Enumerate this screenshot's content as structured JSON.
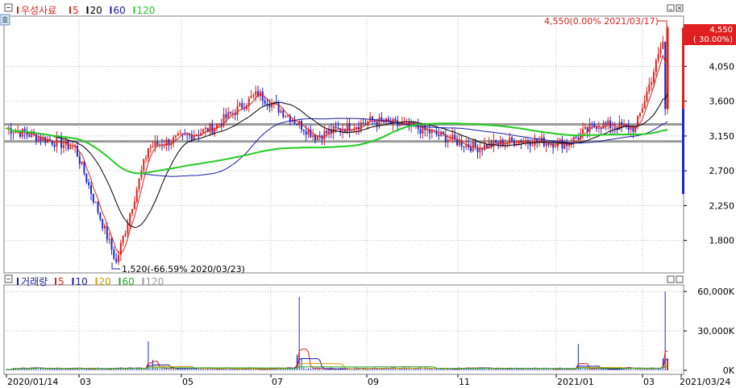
{
  "price_panel": {
    "stock_name": "우성사료",
    "ma_legend": [
      {
        "label": "5",
        "color": "#e0201a"
      },
      {
        "label": "20",
        "color": "#000000"
      },
      {
        "label": "60",
        "color": "#1a1aa8"
      },
      {
        "label": "120",
        "color": "#22cc22"
      }
    ],
    "max_annotation": "4,550(0.00% 2021/03/17)",
    "min_annotation": "1,520(-66.59% 2020/03/23)",
    "current_price_label": "4,550",
    "current_change_label": "( 30.00%)"
  },
  "volume_panel": {
    "title": "거래량",
    "ma_legend": [
      {
        "label": "5",
        "color": "#e0201a"
      },
      {
        "label": "10",
        "color": "#1a1aa8"
      },
      {
        "label": "20",
        "color": "#d49a00"
      },
      {
        "label": "60",
        "color": "#22aa22"
      },
      {
        "label": "120",
        "color": "#999999"
      }
    ]
  },
  "x_axis_labels": [
    "2020/01/14",
    "03",
    "05",
    "07",
    "09",
    "11",
    "2021/01",
    "03",
    "2021/03/24"
  ],
  "chart_data": [
    {
      "type": "candlestick",
      "title": "우성사료",
      "y_ticks": [
        1800,
        2250,
        2700,
        3150,
        3600,
        4050
      ],
      "y_tick_labels": [
        "1,800",
        "2,250",
        "2,700",
        "3,150",
        "3,600",
        "4,050"
      ],
      "ylim": [
        1380,
        4700
      ],
      "horizontal_reference_lines": [
        3300,
        3080
      ],
      "monthly_closes": [
        {
          "x": "2020/01",
          "close": 3250
        },
        {
          "x": "2020/02",
          "close": 3000
        },
        {
          "x": "2020/03",
          "close": 1520
        },
        {
          "x": "2020/04",
          "close": 3000
        },
        {
          "x": "2020/05",
          "close": 3250
        },
        {
          "x": "2020/06",
          "close": 3700
        },
        {
          "x": "2020/07",
          "close": 3150
        },
        {
          "x": "2020/08",
          "close": 3350
        },
        {
          "x": "2020/09",
          "close": 3250
        },
        {
          "x": "2020/10",
          "close": 3000
        },
        {
          "x": "2020/11",
          "close": 3100
        },
        {
          "x": "2020/12",
          "close": 3050
        },
        {
          "x": "2021/01",
          "close": 3300
        },
        {
          "x": "2021/02",
          "close": 3250
        },
        {
          "x": "2021/03",
          "close": 4550
        }
      ],
      "max": {
        "value": 4550,
        "date": "2021/03/17"
      },
      "min": {
        "value": 1520,
        "date": "2020/03/23"
      },
      "last": {
        "value": 4550,
        "change_pct": 30.0
      }
    },
    {
      "type": "bar",
      "title": "거래량",
      "y_ticks": [
        0,
        30000,
        60000
      ],
      "y_tick_labels": [
        "0K",
        "30,000K",
        "60,000K"
      ],
      "ylim": [
        0,
        65000
      ],
      "notable_volumes_k": [
        {
          "x": "2020/04",
          "value": 22000
        },
        {
          "x": "2020/06",
          "value": 56000
        },
        {
          "x": "2021/01",
          "value": 20000
        },
        {
          "x": "2021/03",
          "value": 60000
        }
      ]
    }
  ]
}
